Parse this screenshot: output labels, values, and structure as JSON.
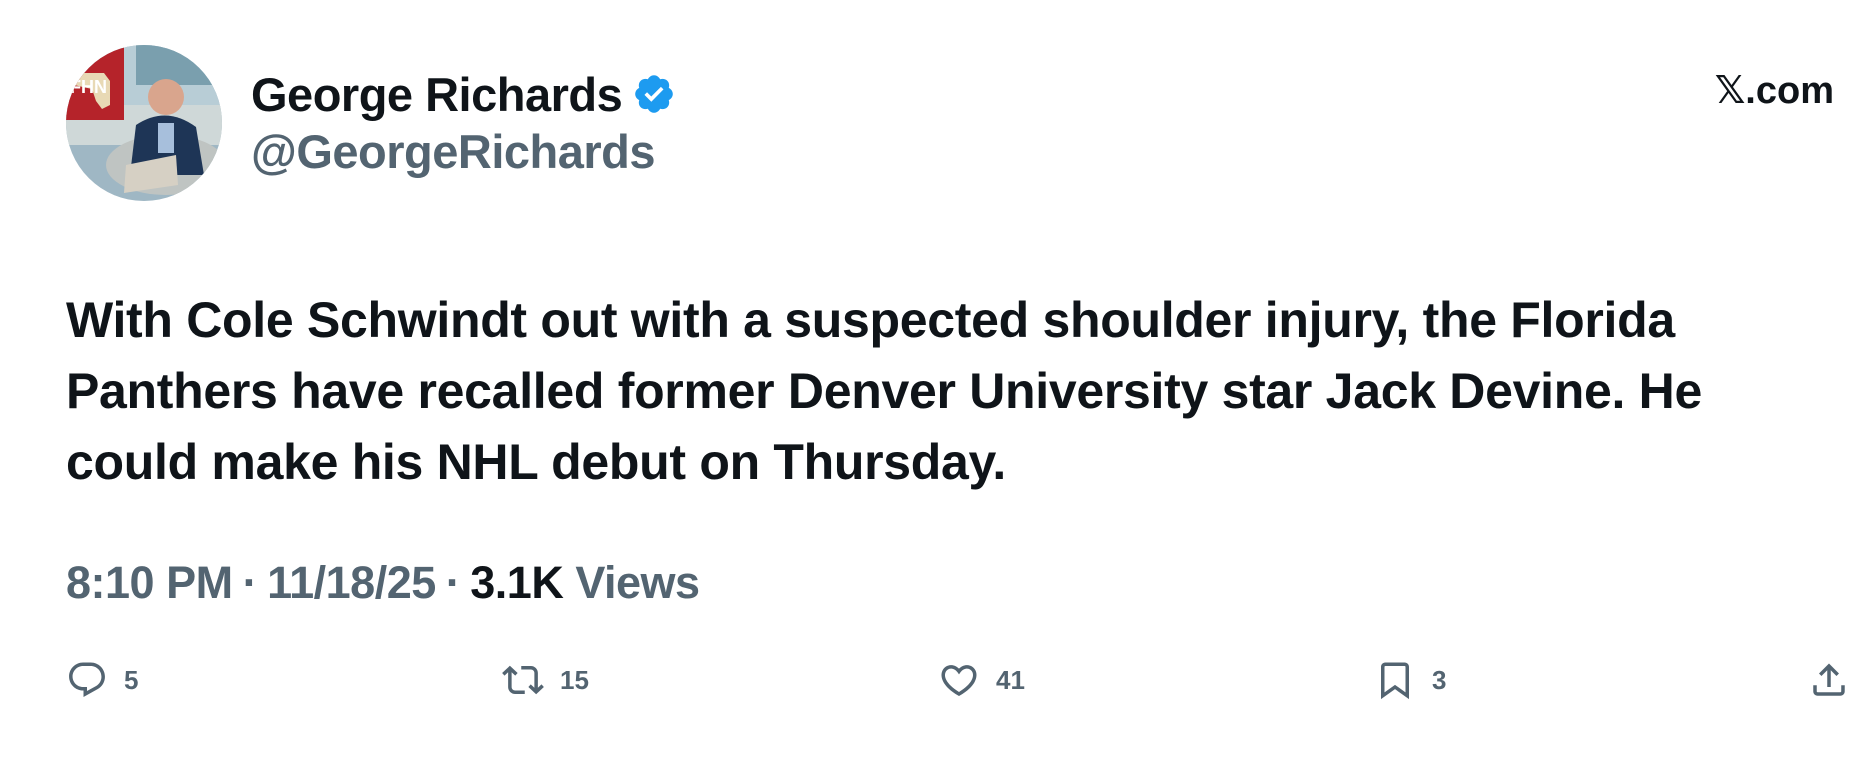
{
  "header": {
    "display_name": "George Richards",
    "handle": "@GeorgeRichards",
    "avatar_badge": "FHN",
    "verified": true,
    "source_label": "𝕏.com",
    "brand_blue": "#1d9bf0"
  },
  "tweet": {
    "text": "With Cole Schwindt out with a suspected shoulder injury, the Florida Panthers have recalled former Denver University star Jack Devine. He could make his NHL debut on Thursday."
  },
  "meta": {
    "time": "8:10 PM",
    "separator": "·",
    "date": "11/18/25",
    "views_count": "3.1K",
    "views_label": "Views"
  },
  "actions": {
    "replies": "5",
    "reposts": "15",
    "likes": "41",
    "bookmarks": "3",
    "icons": [
      "reply-icon",
      "repost-icon",
      "like-icon",
      "bookmark-icon",
      "share-icon"
    ]
  },
  "colors": {
    "text_primary": "#0f1419",
    "text_secondary": "#536471"
  }
}
